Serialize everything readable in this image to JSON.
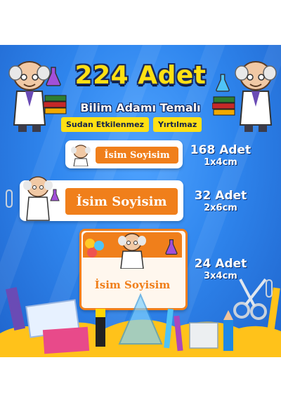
{
  "title": "224 Adet",
  "subtitle": "Bilim Adamı Temalı",
  "badges": [
    "Sudan Etkilenmez",
    "Yırtılmaz"
  ],
  "labels": [
    {
      "text": "İsim Soyisim",
      "count": "168 Adet",
      "dimensions": "1x4cm"
    },
    {
      "text": "İsim Soyisim",
      "count": "32 Adet",
      "dimensions": "2x6cm"
    },
    {
      "text": "İsim Soyisim",
      "count": "24 Adet",
      "dimensions": "3x4cm"
    }
  ],
  "colors": {
    "background_blue": "#2f86ee",
    "title_yellow": "#ffe014",
    "label_orange": "#f07f1b"
  },
  "icons": [
    "scientist-icon",
    "flask-icon",
    "books-icon",
    "abc-icon",
    "pencil-icon",
    "ruler-icon",
    "scissors-icon",
    "paperclip-icon"
  ]
}
